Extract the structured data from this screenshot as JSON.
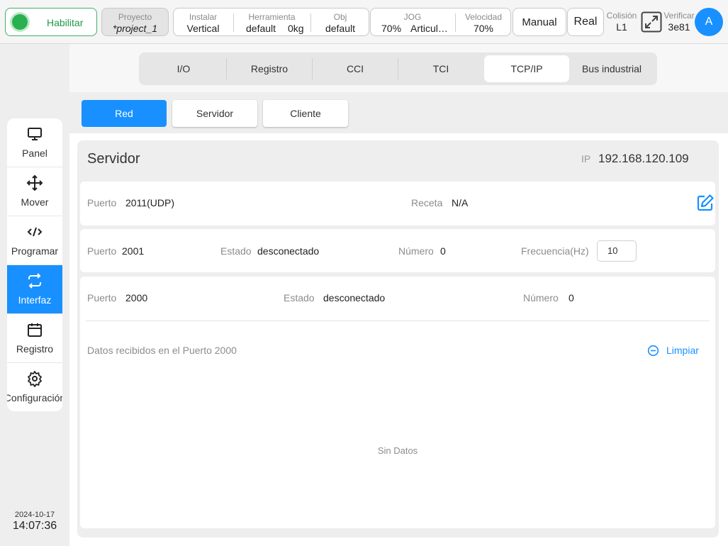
{
  "topbar": {
    "enable_label": "Habilitar",
    "project": {
      "label": "Proyecto",
      "value": "*project_1"
    },
    "install": {
      "label": "Instalar",
      "value": "Vertical"
    },
    "tool": {
      "label": "Herramienta",
      "value": "default",
      "payload": "0kg"
    },
    "obj": {
      "label": "Obj",
      "value": "default"
    },
    "jog": {
      "label": "JOG",
      "percent": "70%",
      "mode": "Articul…"
    },
    "speed": {
      "label": "Velocidad",
      "value": "70%"
    },
    "manual_label": "Manual",
    "real_label": "Real",
    "collision": {
      "label": "Colisión",
      "value": "L1"
    },
    "verify": {
      "label": "Verificar",
      "value": "3e81"
    },
    "avatar_letter": "A"
  },
  "sidebar": {
    "items": [
      {
        "label": "Panel",
        "icon": "monitor-icon"
      },
      {
        "label": "Mover",
        "icon": "move-arrows-icon"
      },
      {
        "label": "Programar",
        "icon": "code-icon"
      },
      {
        "label": "Interfaz",
        "icon": "swap-arrows-icon",
        "active": true
      },
      {
        "label": "Registro",
        "icon": "calendar-icon"
      },
      {
        "label": "Configuración",
        "icon": "gear-icon"
      }
    ],
    "date": "2024-10-17",
    "time": "14:07:36"
  },
  "tabs": [
    {
      "label": "I/O"
    },
    {
      "label": "Registro"
    },
    {
      "label": "CCI"
    },
    {
      "label": "TCI"
    },
    {
      "label": "TCP/IP",
      "active": true
    },
    {
      "label": "Bus industrial"
    }
  ],
  "subtabs": [
    {
      "label": "Red",
      "active": true
    },
    {
      "label": "Servidor"
    },
    {
      "label": "Cliente"
    }
  ],
  "server": {
    "title": "Servidor",
    "ip_label": "IP",
    "ip_value": "192.168.120.109",
    "row1": {
      "port_label": "Puerto",
      "port_value": "2011(UDP)",
      "recipe_label": "Receta",
      "recipe_value": "N/A"
    },
    "row2": {
      "port_label": "Puerto",
      "port_value": "2001",
      "state_label": "Estado",
      "state_value": "desconectado",
      "number_label": "Número",
      "number_value": "0",
      "freq_label": "Frecuencia(Hz)",
      "freq_value": "10"
    },
    "row3": {
      "port_label": "Puerto",
      "port_value": "2000",
      "state_label": "Estado",
      "state_value": "desconectado",
      "number_label": "Número",
      "number_value": "0"
    },
    "received_label": "Datos recibidos en el Puerto 2000",
    "clear_label": "Limpiar",
    "no_data": "Sin Datos"
  },
  "colors": {
    "accent": "#1890ff",
    "enable_green": "#29b04f"
  }
}
